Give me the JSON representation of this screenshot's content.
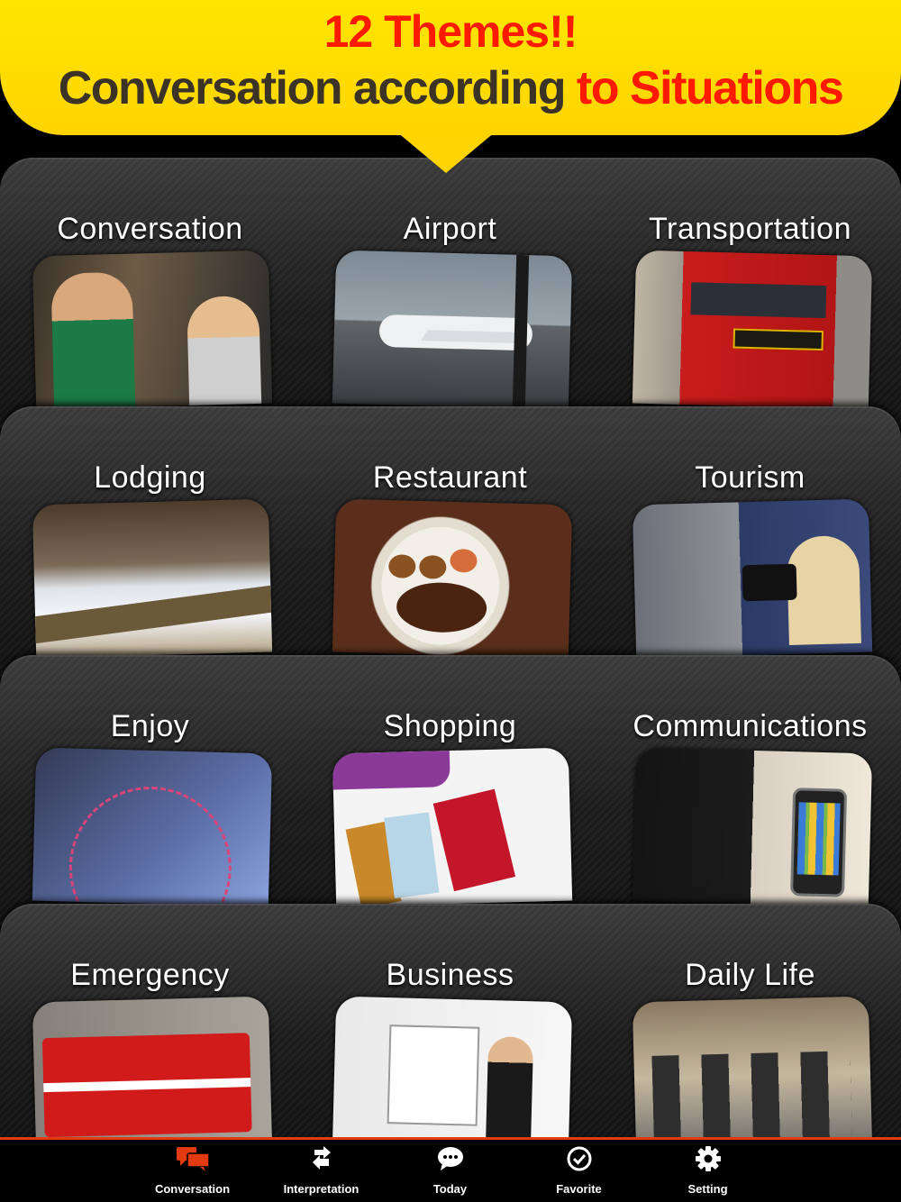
{
  "banner": {
    "title": "12 Themes!!",
    "subtitle_main": "Conversation according ",
    "subtitle_highlight": "to Situations"
  },
  "themes": [
    {
      "label": "Conversation"
    },
    {
      "label": "Airport"
    },
    {
      "label": "Transportation"
    },
    {
      "label": "Lodging"
    },
    {
      "label": "Restaurant"
    },
    {
      "label": "Tourism"
    },
    {
      "label": "Enjoy"
    },
    {
      "label": "Shopping"
    },
    {
      "label": "Communications"
    },
    {
      "label": "Emergency"
    },
    {
      "label": "Business"
    },
    {
      "label": "Daily Life"
    }
  ],
  "tabbar": {
    "active_tab": "Conversation",
    "accent_color": "#e23b12",
    "tabs": [
      {
        "label": "Conversation",
        "icon": "chat-bubbles-icon"
      },
      {
        "label": "Interpretation",
        "icon": "swap-arrows-icon"
      },
      {
        "label": "Today",
        "icon": "speech-bubble-icon"
      },
      {
        "label": "Favorite",
        "icon": "check-circle-icon"
      },
      {
        "label": "Setting",
        "icon": "gear-icon"
      }
    ]
  }
}
